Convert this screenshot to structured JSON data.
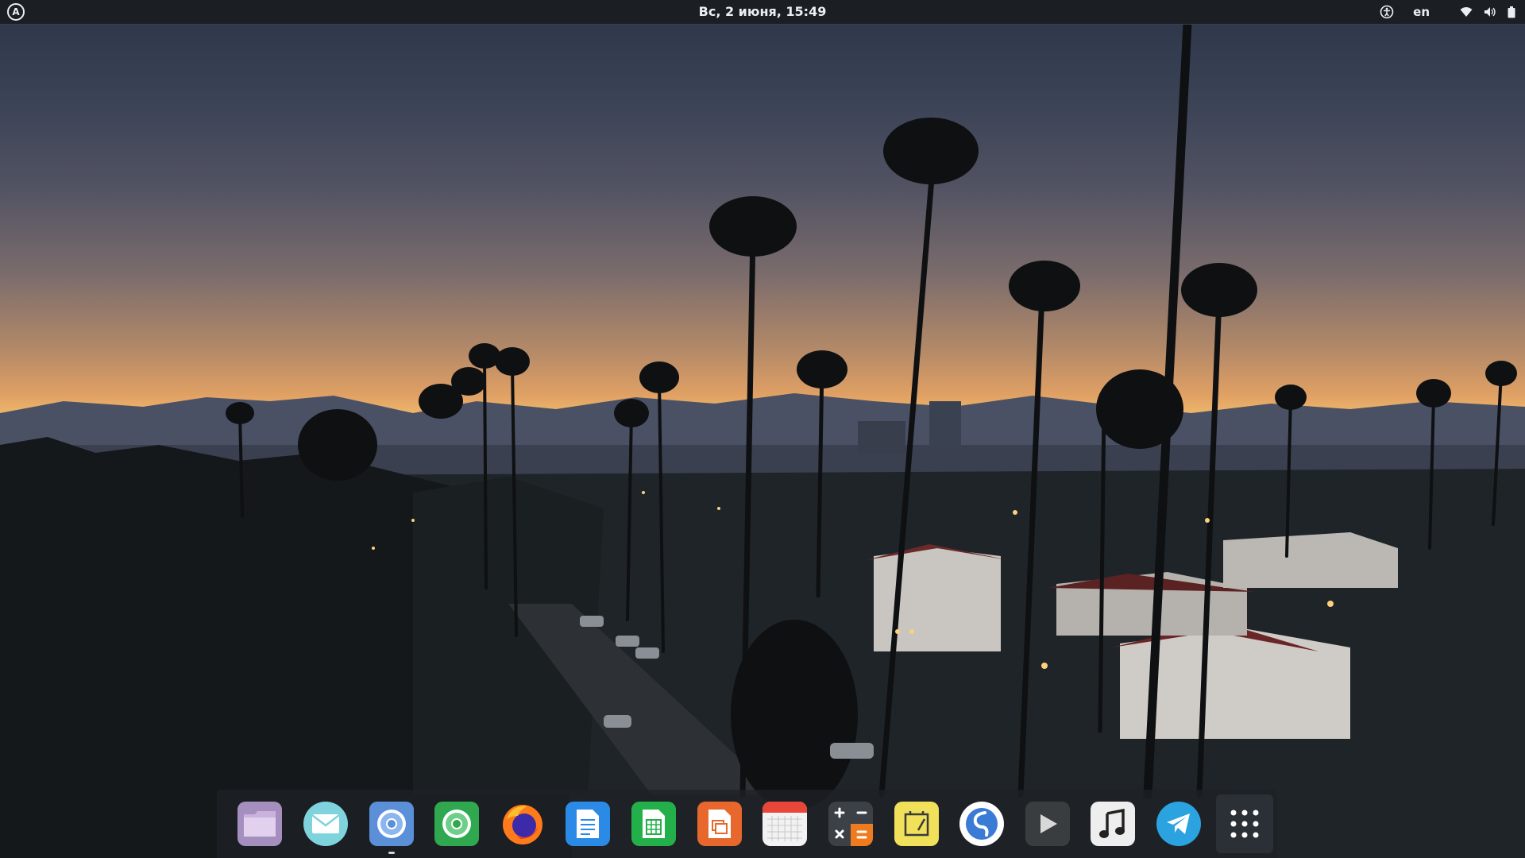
{
  "topbar": {
    "clock": "Вс, 2 июня, 15:49",
    "keyboard_layout": "en",
    "activities_icon": "a-logo-icon",
    "tray_icons": [
      "accessibility-icon",
      "wifi-icon",
      "volume-icon",
      "battery-icon"
    ]
  },
  "dock": {
    "items": [
      {
        "name": "files",
        "icon": "folder-icon",
        "color": "#b08ec0"
      },
      {
        "name": "mail",
        "icon": "mail-icon",
        "color": "#7fd0d9"
      },
      {
        "name": "chromium",
        "icon": "chromium-icon",
        "color": "#5b8fd8",
        "running": true
      },
      {
        "name": "chrome",
        "icon": "chrome-icon",
        "color": "#2fa84f"
      },
      {
        "name": "firefox",
        "icon": "firefox-icon",
        "color": "#ff7a1a"
      },
      {
        "name": "writer",
        "icon": "document-icon",
        "color": "#2a8ae6"
      },
      {
        "name": "calc",
        "icon": "spreadsheet-icon",
        "color": "#23b04a"
      },
      {
        "name": "impress",
        "icon": "presentation-icon",
        "color": "#e8672c"
      },
      {
        "name": "calendar",
        "icon": "calendar-icon",
        "color": "#e9463a"
      },
      {
        "name": "calculator",
        "icon": "calculator-icon",
        "color": "#444a52"
      },
      {
        "name": "notes",
        "icon": "notes-icon",
        "color": "#f0e05a"
      },
      {
        "name": "simplenote",
        "icon": "simplenote-icon",
        "color": "#3a7bd5"
      },
      {
        "name": "video",
        "icon": "play-icon",
        "color": "#3a3d40"
      },
      {
        "name": "music",
        "icon": "music-icon",
        "color": "#eeeeee"
      },
      {
        "name": "telegram",
        "icon": "telegram-icon",
        "color": "#2aa3e0"
      },
      {
        "name": "show-applications",
        "icon": "app-grid-icon",
        "color": "#2b2f36"
      }
    ]
  }
}
